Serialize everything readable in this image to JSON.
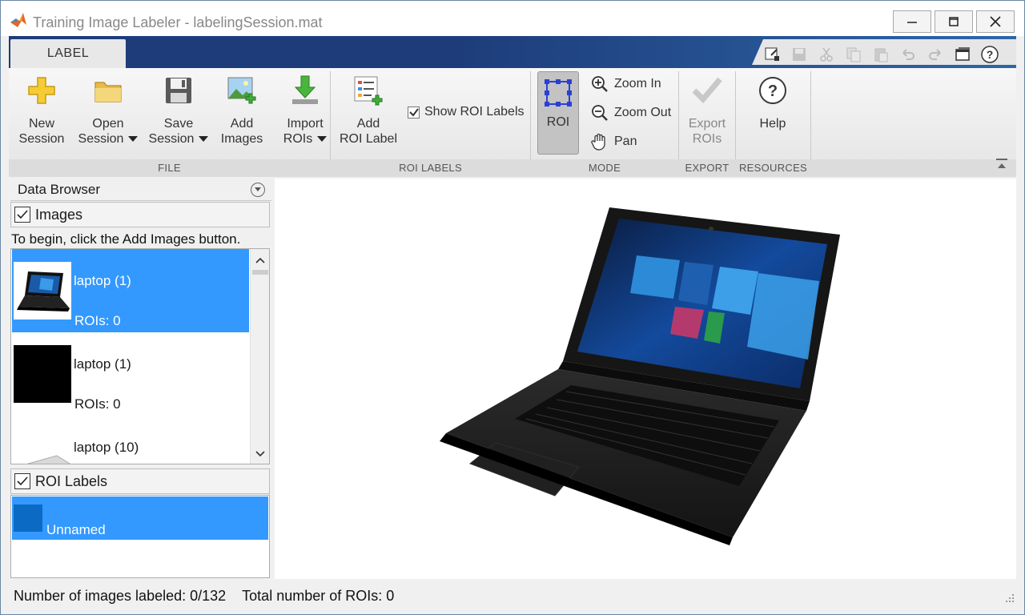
{
  "window": {
    "title": "Training Image Labeler - labelingSession.mat"
  },
  "ribbon": {
    "tab": "LABEL",
    "file": {
      "group_label": "FILE",
      "new_session": [
        "New",
        "Session"
      ],
      "open_session": [
        "Open",
        "Session"
      ],
      "save_session": [
        "Save",
        "Session"
      ],
      "add_images": [
        "Add",
        "Images"
      ],
      "import_rois": [
        "Import",
        "ROIs"
      ]
    },
    "roi_labels": {
      "group_label": "ROI LABELS",
      "add_roi_label": [
        "Add",
        "ROI Label"
      ],
      "show_roi_labels": "Show ROI Labels",
      "show_roi_labels_checked": true
    },
    "mode": {
      "group_label": "MODE",
      "roi": "ROI",
      "zoom_in": "Zoom In",
      "zoom_out": "Zoom Out",
      "pan": "Pan"
    },
    "export": {
      "group_label": "EXPORT",
      "export_rois": [
        "Export",
        "ROIs"
      ]
    },
    "resources": {
      "group_label": "RESOURCES",
      "help": "Help"
    }
  },
  "data_browser": {
    "title": "Data Browser",
    "images_section": {
      "label": "Images",
      "checked": true,
      "hint": "To begin, click the Add Images button.",
      "items": [
        {
          "name": "laptop (1)",
          "rois": "ROIs: 0",
          "selected": true,
          "thumb": "laptop-photo"
        },
        {
          "name": "laptop (1)",
          "rois": "ROIs: 0",
          "selected": false,
          "thumb": "black"
        },
        {
          "name": "laptop (10)",
          "rois": "",
          "selected": false,
          "thumb": "silver-laptop"
        }
      ]
    },
    "roi_labels_section": {
      "label": "ROI Labels",
      "checked": true,
      "items": [
        {
          "name": "Unnamed",
          "color": "#0b6bc4",
          "selected": true
        }
      ]
    }
  },
  "status": {
    "labeled": "Number of images labeled: 0/132",
    "total_rois": "Total number of ROIs: 0"
  },
  "colors": {
    "ribbon_tabstrip": "#1e3c7a",
    "selection": "#3399ff",
    "roi_swatch": "#0b6bc4"
  }
}
